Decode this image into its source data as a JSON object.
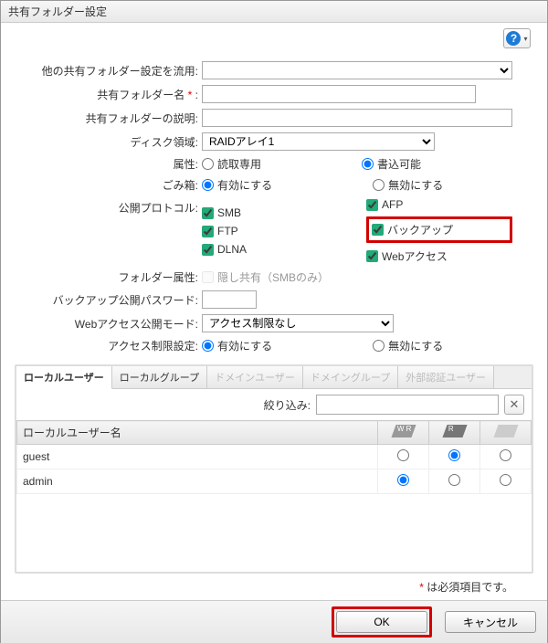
{
  "window": {
    "title": "共有フォルダー設定"
  },
  "help": {
    "tooltip": "ヘルプ"
  },
  "labels": {
    "reuse": "他の共有フォルダー設定を流用:",
    "name": "共有フォルダー名",
    "desc": "共有フォルダーの説明:",
    "volume": "ディスク領域:",
    "attr": "属性:",
    "trash": "ごみ箱:",
    "proto": "公開プロトコル:",
    "folder_attr": "フォルダー属性:",
    "backup_pw": "バックアップ公開パスワード:",
    "web_mode": "Webアクセス公開モード:",
    "access": "アクセス制限設定:"
  },
  "values": {
    "reuse": "",
    "name": "",
    "desc": "",
    "volume": "RAIDアレイ1",
    "backup_pw": "",
    "web_mode": "アクセス制限なし"
  },
  "radios": {
    "attr_ro": "読取専用",
    "attr_rw": "書込可能",
    "trash_on": "有効にする",
    "trash_off": "無効にする",
    "access_on": "有効にする",
    "access_off": "無効にする"
  },
  "protocols": {
    "smb": "SMB",
    "ftp": "FTP",
    "dlna": "DLNA",
    "afp": "AFP",
    "backup": "バックアップ",
    "webaccess": "Webアクセス"
  },
  "folder_attr_hidden": "隠し共有（SMBのみ）",
  "tabs": {
    "t1": "ローカルユーザー",
    "t2": "ローカルグループ",
    "t3": "ドメインユーザー",
    "t4": "ドメイングループ",
    "t5": "外部認証ユーザー"
  },
  "filter": {
    "label": "絞り込み:",
    "value": ""
  },
  "user_table": {
    "col_name": "ローカルユーザー名",
    "rows": [
      {
        "name": "guest",
        "perm": "r"
      },
      {
        "name": "admin",
        "perm": "wr"
      }
    ]
  },
  "reqnote": {
    "star": "*",
    "text": " は必須項目です。"
  },
  "buttons": {
    "ok": "OK",
    "cancel": "キャンセル"
  }
}
